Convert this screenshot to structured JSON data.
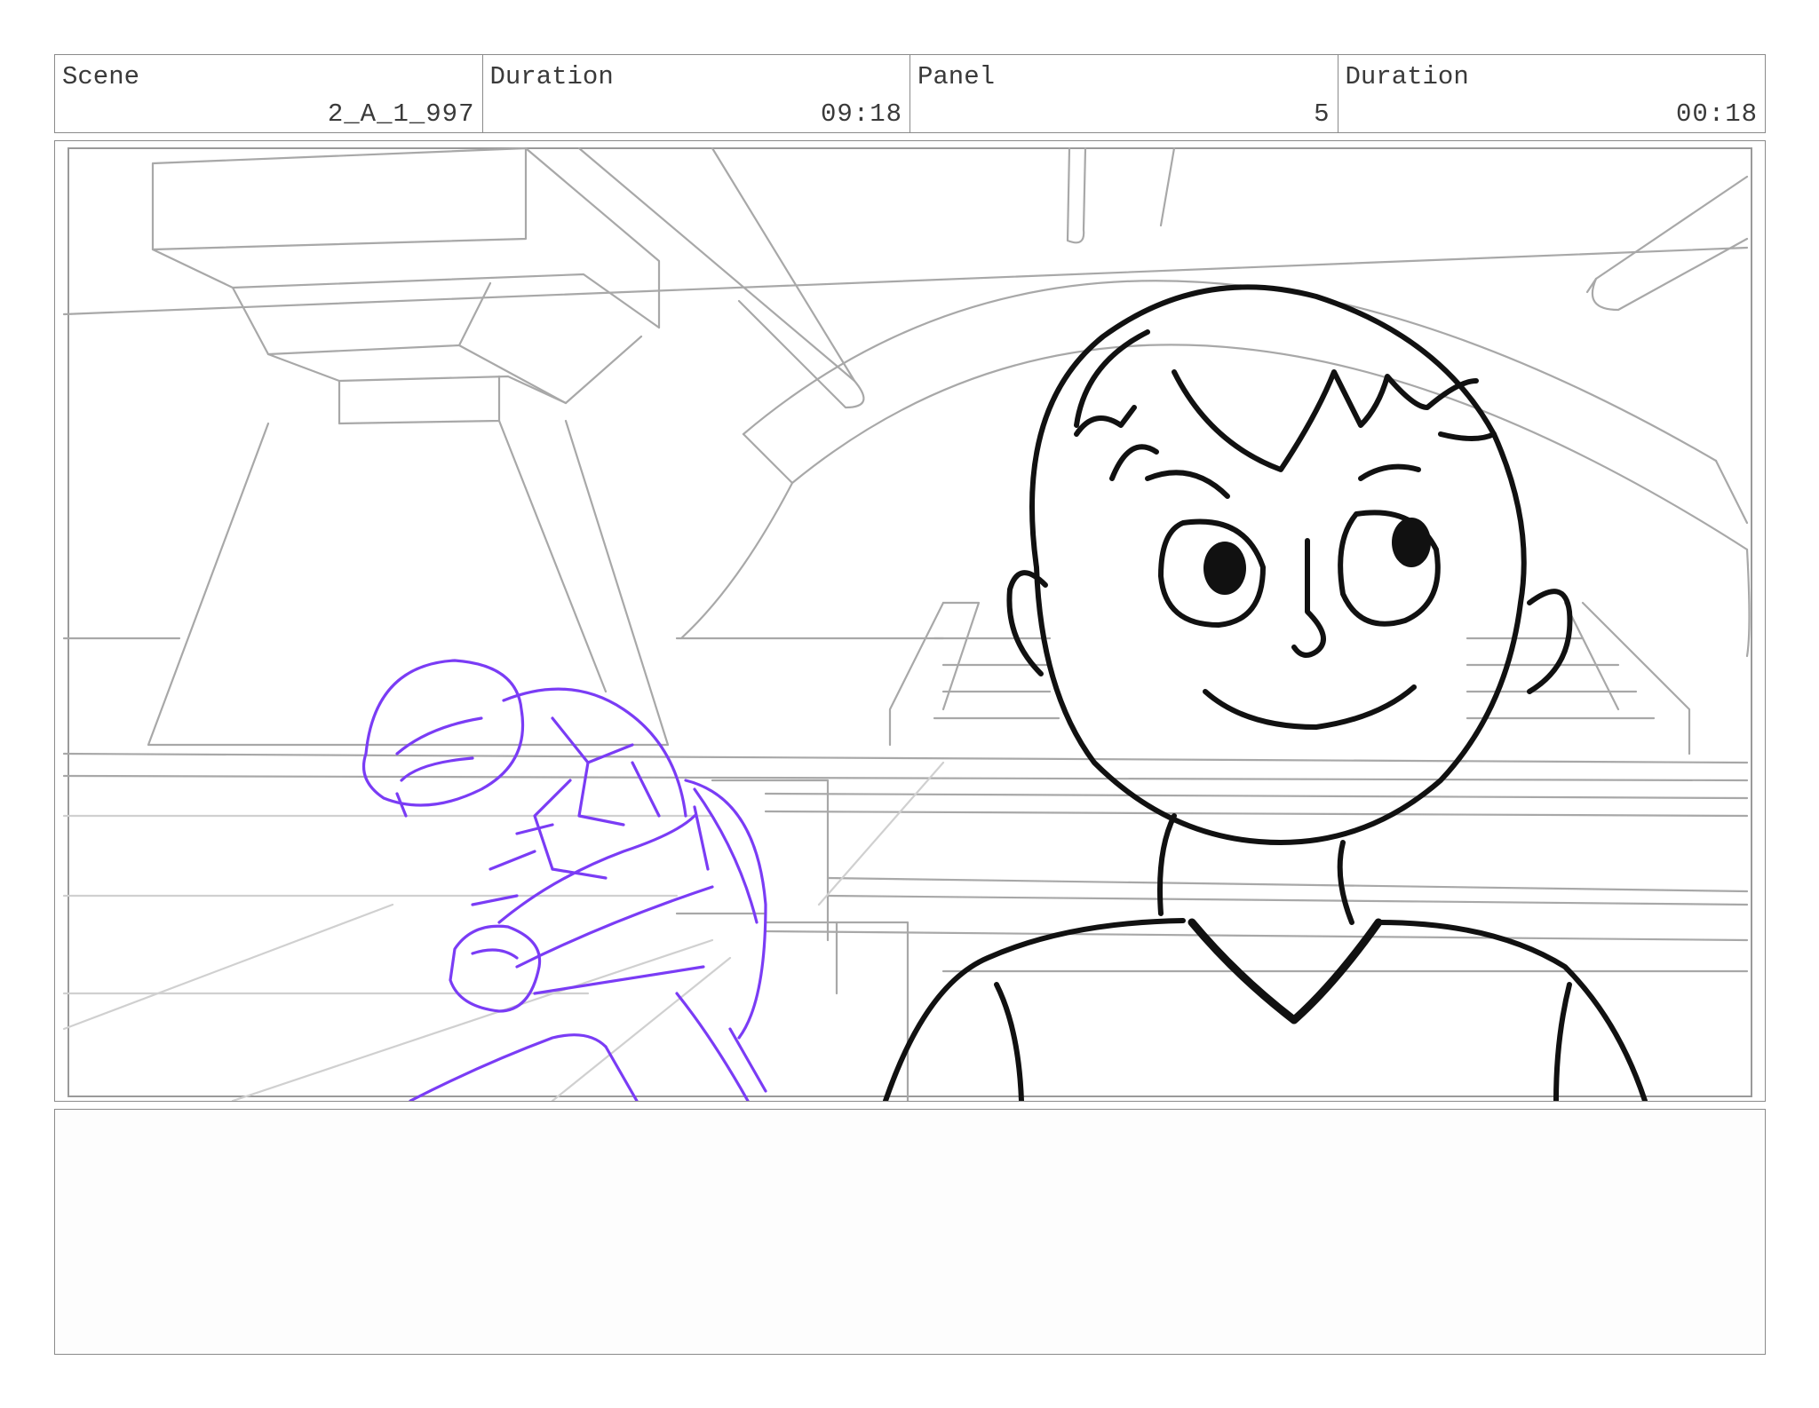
{
  "header": {
    "scene_label": "Scene",
    "scene_value": "2_A_1_997",
    "scene_duration_label": "Duration",
    "scene_duration_value": "09:18",
    "panel_label": "Panel",
    "panel_value": "5",
    "panel_duration_label": "Duration",
    "panel_duration_value": "00:18"
  },
  "notes": {
    "text": ""
  },
  "colors": {
    "border": "#8a8a8a",
    "background_lines": "#a8a8a8",
    "character_line": "#111111",
    "turtle_line": "#7a3cf5"
  }
}
